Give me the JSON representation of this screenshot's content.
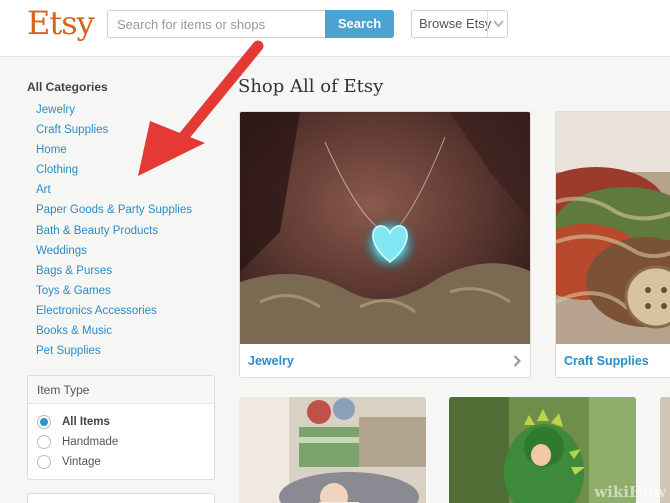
{
  "header": {
    "logo": "Etsy",
    "search_placeholder": "Search for items or shops",
    "search_button": "Search",
    "browse_label": "Browse Etsy"
  },
  "sidebar": {
    "heading": "All Categories",
    "categories": [
      "Jewelry",
      "Craft Supplies",
      "Home",
      "Clothing",
      "Art",
      "Paper Goods & Party Supplies",
      "Bath & Beauty Products",
      "Weddings",
      "Bags & Purses",
      "Toys & Games",
      "Electronics Accessories",
      "Books & Music",
      "Pet Supplies"
    ],
    "item_type": {
      "heading": "Item Type",
      "options": [
        "All Items",
        "Handmade",
        "Vintage"
      ],
      "selected": "All Items"
    }
  },
  "main": {
    "title": "Shop All of Etsy",
    "cards": [
      {
        "label": "Jewelry"
      },
      {
        "label": "Craft Supplies"
      }
    ]
  },
  "watermark": "wikiHow",
  "colors": {
    "logo": "#d5641c",
    "link": "#2c8cc5",
    "search_button": "#4aa3d0",
    "arrow": "#e53935"
  }
}
